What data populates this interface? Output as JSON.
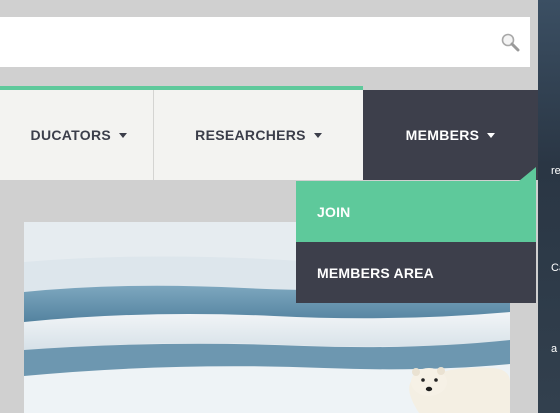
{
  "search": {
    "placeholder": "",
    "icon": "search-icon"
  },
  "nav": {
    "items": [
      {
        "label": "EDUCATORS",
        "partial_label": "DUCATORS"
      },
      {
        "label": "RESEARCHERS"
      },
      {
        "label": "MEMBERS",
        "active": true
      }
    ]
  },
  "dropdown": {
    "items": [
      {
        "label": "JOIN",
        "highlighted": true
      },
      {
        "label": "MEMBERS AREA"
      }
    ]
  },
  "edge": {
    "fragments": [
      "re",
      "Ca",
      "a"
    ]
  },
  "colors": {
    "accent": "#5ec99b",
    "dark": "#3d3f4b",
    "nav_bg": "#f3f3f1"
  }
}
